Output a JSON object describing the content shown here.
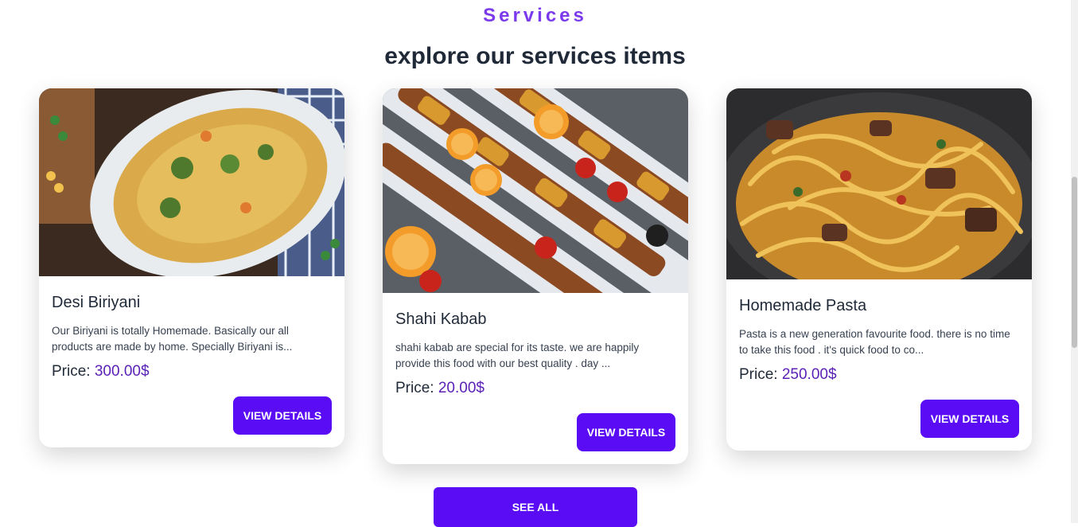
{
  "section": {
    "eyebrow": "Services",
    "title": "explore our services items"
  },
  "cards": [
    {
      "title": "Desi Biriyani",
      "description": "Our Biriyani is totally Homemade. Basically our all products are made by home. Specially Biriyani is...",
      "price_label": "Price:",
      "price": "300.00$",
      "button": "VIEW DETAILS"
    },
    {
      "title": "Shahi Kabab",
      "description": "shahi kabab are special for its taste. we are happily provide this food with our best quality . day ...",
      "price_label": "Price:",
      "price": "20.00$",
      "button": "VIEW DETAILS"
    },
    {
      "title": "Homemade Pasta",
      "description": "Pasta is a new generation favourite food. there is no time to take this food . it's quick food to co...",
      "price_label": "Price:",
      "price": "250.00$",
      "button": "VIEW DETAILS"
    }
  ],
  "see_all": "SEE ALL",
  "colors": {
    "accent": "#5a0cf5",
    "eyebrow": "#7c3aed",
    "price": "#5b21b6"
  }
}
